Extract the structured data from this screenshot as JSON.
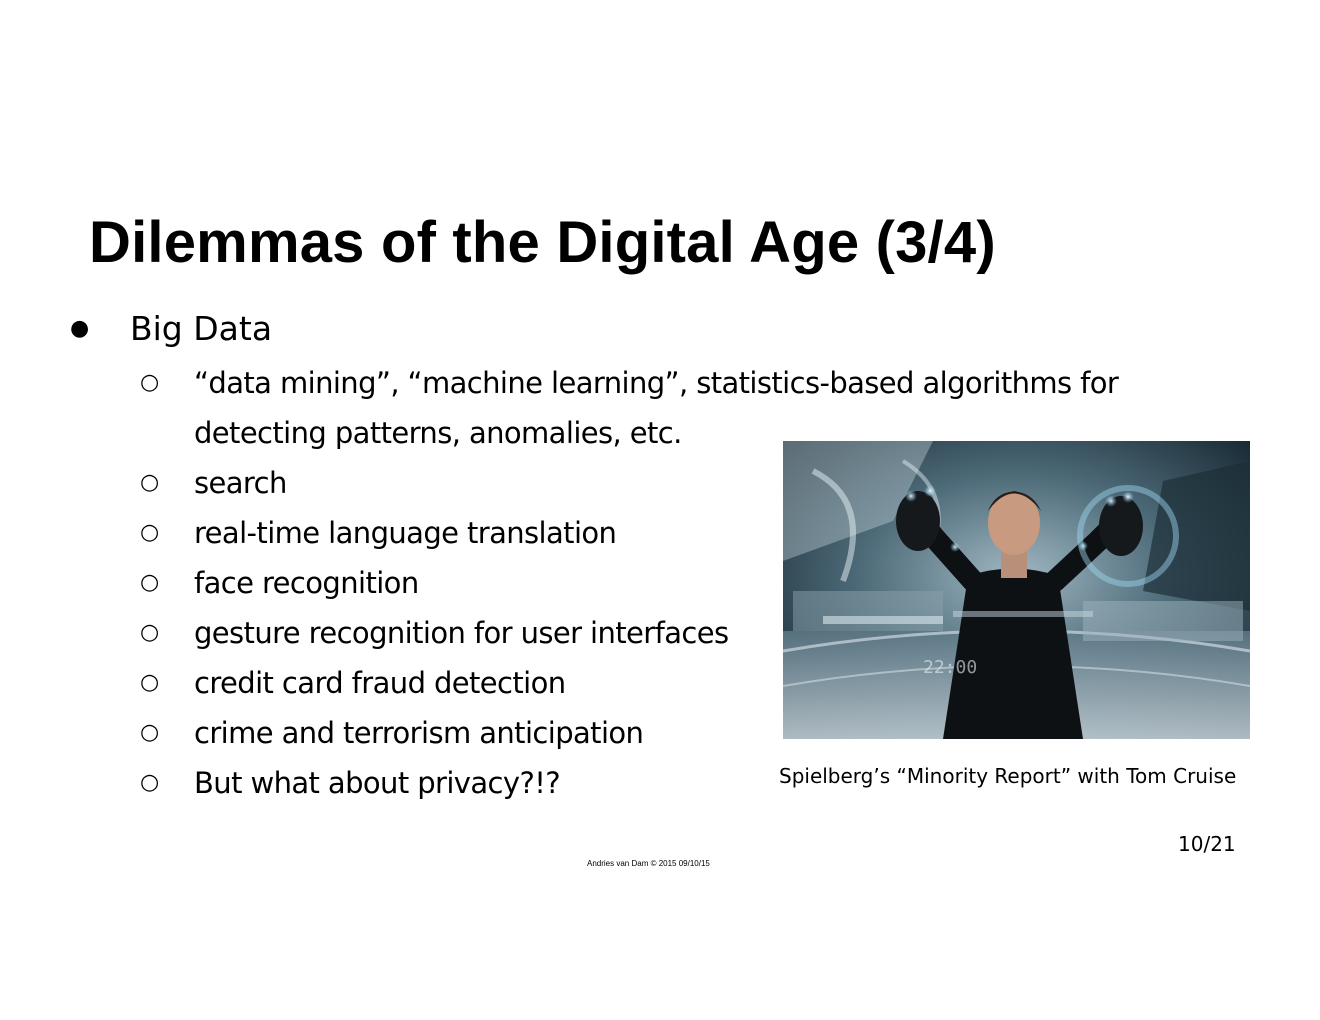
{
  "slide": {
    "title": "Dilemmas of the Digital Age (3/4)",
    "bullet": {
      "marker": "●",
      "label": "Big Data"
    },
    "sub_marker": "○",
    "sub_items": [
      {
        "line1": "“data mining”, “machine learning”, statistics-based algorithms for",
        "line2": "detecting patterns, anomalies, etc."
      },
      {
        "line1": "search"
      },
      {
        "line1": "real-time language translation"
      },
      {
        "line1": "face recognition"
      },
      {
        "line1": "gesture recognition for user interfaces"
      },
      {
        "line1": "credit card fraud detection"
      },
      {
        "line1": "crime and terrorism anticipation"
      },
      {
        "line1": "But what about privacy?!?"
      }
    ],
    "image_caption": "Spielberg’s “Minority Report” with Tom Cruise",
    "page_number": "10/21",
    "footer": "Andries van Dam © 2015 09/10/15"
  }
}
